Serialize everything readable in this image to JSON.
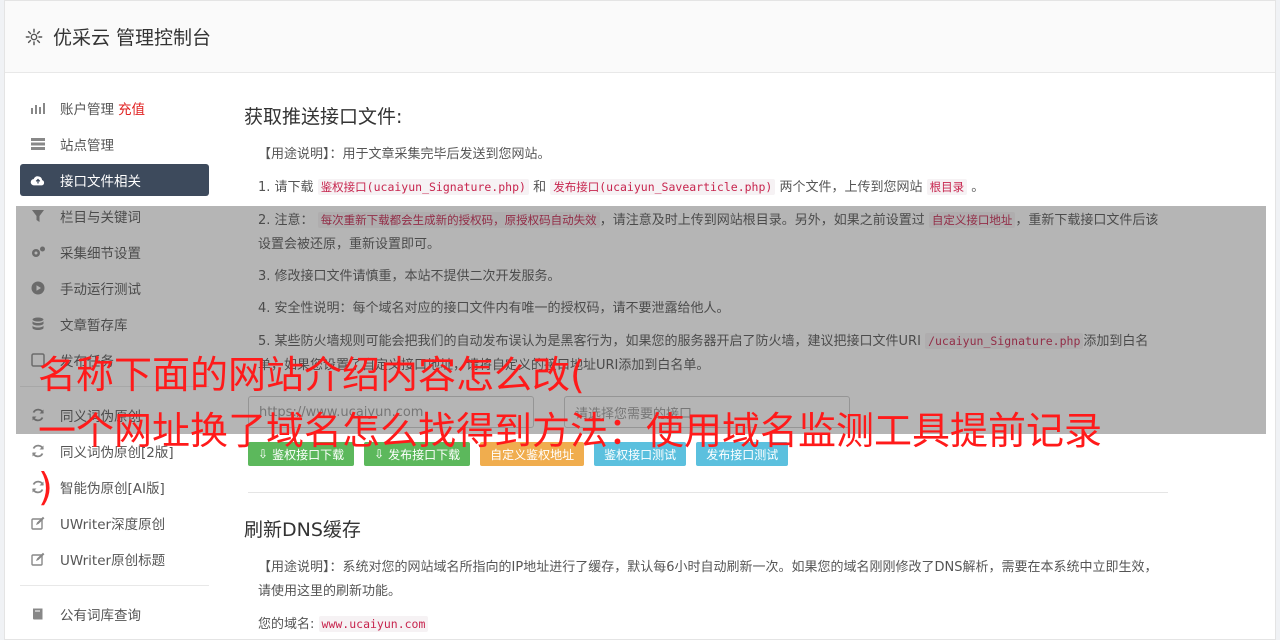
{
  "header": {
    "title": "优采云 管理控制台"
  },
  "sidebar": {
    "items": [
      {
        "label": "账户管理",
        "badge": "充值",
        "icon": "bar-chart-icon"
      },
      {
        "label": "站点管理",
        "icon": "server-icon"
      },
      {
        "label": "接口文件相关",
        "icon": "cloud-upload-icon",
        "active": true
      },
      {
        "label": "栏目与关键词",
        "icon": "filter-icon"
      },
      {
        "label": "采集细节设置",
        "icon": "cogs-icon"
      },
      {
        "label": "手动运行测试",
        "icon": "play-icon"
      },
      {
        "label": "文章暂存库",
        "icon": "database-icon"
      },
      {
        "label": "发布任务",
        "icon": "checkbox-icon"
      },
      {
        "label": "同义词伪原创",
        "icon": "refresh-icon"
      },
      {
        "label": "同义词伪原创[2版]",
        "icon": "refresh-icon"
      },
      {
        "label": "智能伪原创[AI版]",
        "icon": "refresh-icon"
      },
      {
        "label": "UWriter深度原创",
        "icon": "edit-icon"
      },
      {
        "label": "UWriter原创标题",
        "icon": "edit-icon"
      },
      {
        "label": "公有词库查询",
        "icon": "book-icon"
      }
    ]
  },
  "section1": {
    "title": "获取推送接口文件:",
    "usage_label": "【用途说明】",
    "usage_text": "：用于文章采集完毕后发送到您网站。",
    "p1_a": "1. 请下载",
    "p1_code1": "鉴权接口(ucaiyun_Signature.php)",
    "p1_b": "和",
    "p1_code2": "发布接口(ucaiyun_Savearticle.php)",
    "p1_c": "两个文件，上传到您网站",
    "p1_code3": "根目录",
    "p1_d": "。",
    "p2_a": "2. 注意：",
    "p2_code1": "每次重新下载都会生成新的授权码，原授权码自动失效",
    "p2_b": "，请注意及时上传到网站根目录。另外，如果之前设置过",
    "p2_code2": "自定义接口地址",
    "p2_c": "，重新下载接口文件后该设置会被还原，重新设置即可。",
    "p3": "3. 修改接口文件请慎重，本站不提供二次开发服务。",
    "p4": "4. 安全性说明：每个域名对应的接口文件内有唯一的授权码，请不要泄露给他人。",
    "p5_a": "5. 某些防火墙规则可能会把我们的自动发布误认为是黑客行为，如果您的服务器开启了防火墙，建议把接口文件URI",
    "p5_code": "/ucaiyun_Signature.php",
    "p5_b": "添加到白名单，如果您设置了自定义接口地址，请将自定义的接口地址URI添加到白名单。",
    "url_placeholder": "https://www.ucaiyun.com",
    "select_placeholder": "请选择您需要的接口",
    "buttons": [
      "鉴权接口下载",
      "发布接口下载",
      "自定义鉴权地址",
      "鉴权接口测试",
      "发布接口测试"
    ]
  },
  "section2": {
    "title": "刷新DNS缓存",
    "usage_label": "【用途说明】",
    "usage_text": "：系统对您的网站域名所指向的IP地址进行了缓存，默认每6小时自动刷新一次。如果您的域名刚刚修改了DNS解析，需要在本系统中立即生效，请使用这里的刷新功能。",
    "domain_label": "您的域名:",
    "domain_value": "www.ucaiyun.com"
  },
  "overlay": {
    "line1": "名称下面的网站介绍内容怎么改(",
    "line2": "一个网址换了域名怎么找得到方法：使用域名监测工具提前记录",
    "line3": ")"
  },
  "colors": {
    "active_nav": "#3d4a5c",
    "overlay_text": "#ff1a1a",
    "code": "#c7254e"
  }
}
